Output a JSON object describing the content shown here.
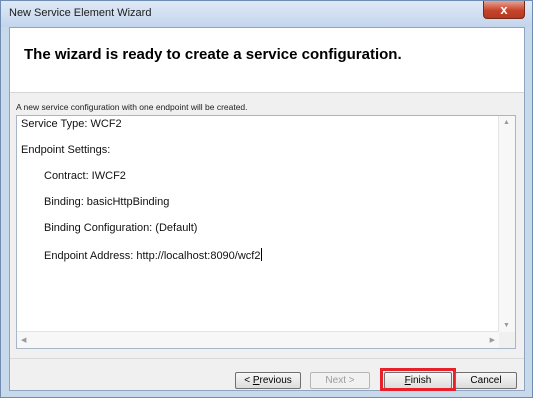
{
  "window": {
    "title": "New Service Element Wizard",
    "close_glyph": "x"
  },
  "header": {
    "title": "The wizard is ready to create a service configuration."
  },
  "description": "A new service configuration with one endpoint will be created.",
  "summary": {
    "service_type": "Service Type: WCF2",
    "endpoint_settings": "Endpoint Settings:",
    "contract": "Contract: IWCF2",
    "binding": "Binding: basicHttpBinding",
    "binding_configuration": "Binding Configuration: (Default)",
    "endpoint_address": "Endpoint Address: http://localhost:8090/wcf2"
  },
  "buttons": {
    "previous": {
      "prefix": "< ",
      "mnemonic": "P",
      "rest": "revious"
    },
    "next": "Next >",
    "finish": {
      "mnemonic": "F",
      "rest": "inish"
    },
    "cancel": "Cancel"
  },
  "colors": {
    "highlight": "#e8202a",
    "title_bar": "#c9d9ec",
    "close_button": "#c7442b"
  },
  "icons": {
    "close": "close-icon",
    "scroll_up": "scroll-up-arrow-icon",
    "scroll_down": "scroll-down-arrow-icon",
    "scroll_left": "scroll-left-arrow-icon",
    "scroll_right": "scroll-right-arrow-icon"
  }
}
